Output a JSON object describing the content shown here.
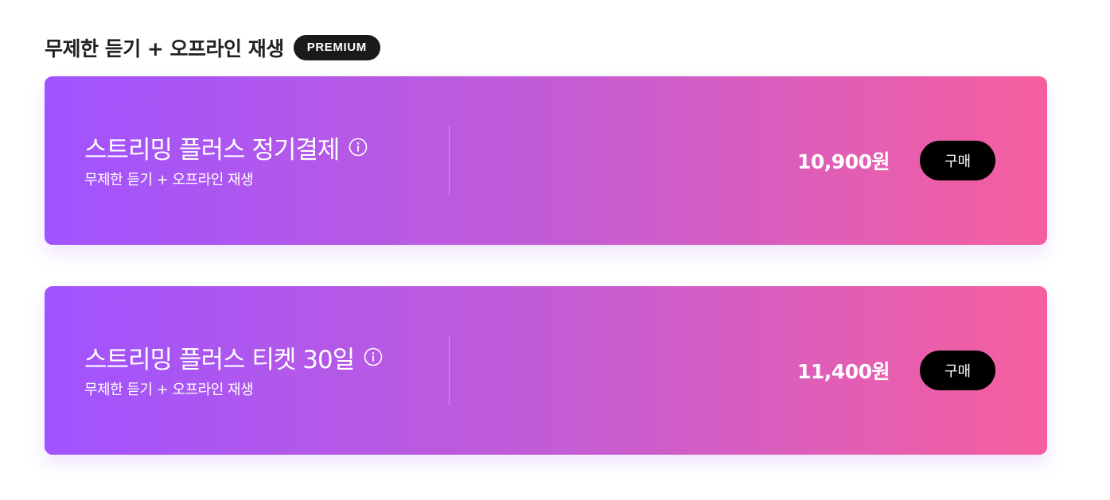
{
  "header": {
    "title": "무제한 듣기 + 오프라인 재생",
    "badge": "PREMIUM"
  },
  "plans": [
    {
      "name": "스트리밍 플러스 정기결제",
      "description": "무제한 듣기 + 오프라인 재생",
      "price": "10,900원",
      "buy_label": "구매"
    },
    {
      "name": "스트리밍 플러스 티켓 30일",
      "description": "무제한 듣기 + 오프라인 재생",
      "price": "11,400원",
      "buy_label": "구매"
    }
  ],
  "icons": {
    "info": "info-circle-icon"
  },
  "colors": {
    "gradient_start": "#a153ff",
    "gradient_mid": "#c25cd6",
    "gradient_end": "#f65f9e",
    "badge_bg": "#1a1a1a",
    "button_bg": "#000000",
    "title_text": "#222222"
  }
}
